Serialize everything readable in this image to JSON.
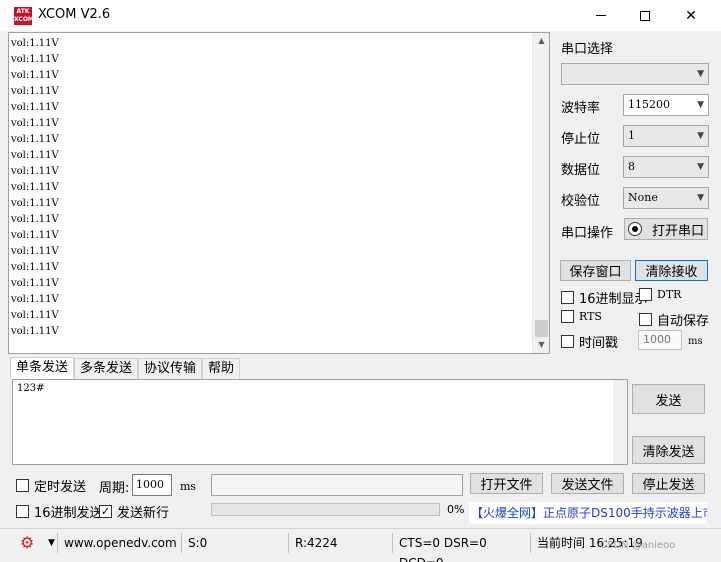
{
  "window": {
    "logo_text": "ATK\nXCOM",
    "title": "XCOM V2.6"
  },
  "receive": {
    "lines": [
      "vol:1.11V",
      "vol:1.11V",
      "vol:1.11V",
      "vol:1.11V",
      "vol:1.11V",
      "vol:1.11V",
      "vol:1.11V",
      "vol:1.11V",
      "vol:1.11V",
      "vol:1.11V",
      "vol:1.11V",
      "vol:1.11V",
      "vol:1.11V",
      "vol:1.11V",
      "vol:1.11V",
      "vol:1.11V",
      "vol:1.11V",
      "vol:1.11V",
      "vol:1.11V"
    ]
  },
  "settings": {
    "port_select_label": "串口选择",
    "port_value": "",
    "baud_label": "波特率",
    "baud_value": "115200",
    "stop_label": "停止位",
    "stop_value": "1",
    "data_label": "数据位",
    "data_value": "8",
    "parity_label": "校验位",
    "parity_value": "None",
    "op_label": "串口操作",
    "open_port": "打开串口"
  },
  "actions": {
    "save_window": "保存窗口",
    "clear_receive": "清除接收"
  },
  "options": {
    "hex_display": "16进制显示",
    "dtr": "DTR",
    "rts": "RTS",
    "auto_save": "自动保存",
    "timestamp": "时间戳",
    "timestamp_ms": "1000",
    "ms": "ms"
  },
  "tabs": [
    "单条发送",
    "多条发送",
    "协议传输",
    "帮助"
  ],
  "send": {
    "text": "123#",
    "send_button": "发送",
    "clear_send": "清除发送",
    "timed_send": "定时发送",
    "period_label": "周期:",
    "period_value": "1000",
    "ms": "ms",
    "file_path": "",
    "open_file": "打开文件",
    "send_file": "发送文件",
    "stop_send": "停止发送",
    "hex_send": "16进制发送",
    "send_newline": "发送新行",
    "progress_percent": "0%",
    "ad_text": "【火爆全网】正点原子DS100手持示波器上市"
  },
  "status": {
    "url": "www.openedv.com",
    "sent": "S:0",
    "received": "R:4224",
    "signals": "CTS=0 DSR=0 DCD=0",
    "time": "当前时间 16:25:19",
    "watermark": "CSDN @anieoo"
  }
}
